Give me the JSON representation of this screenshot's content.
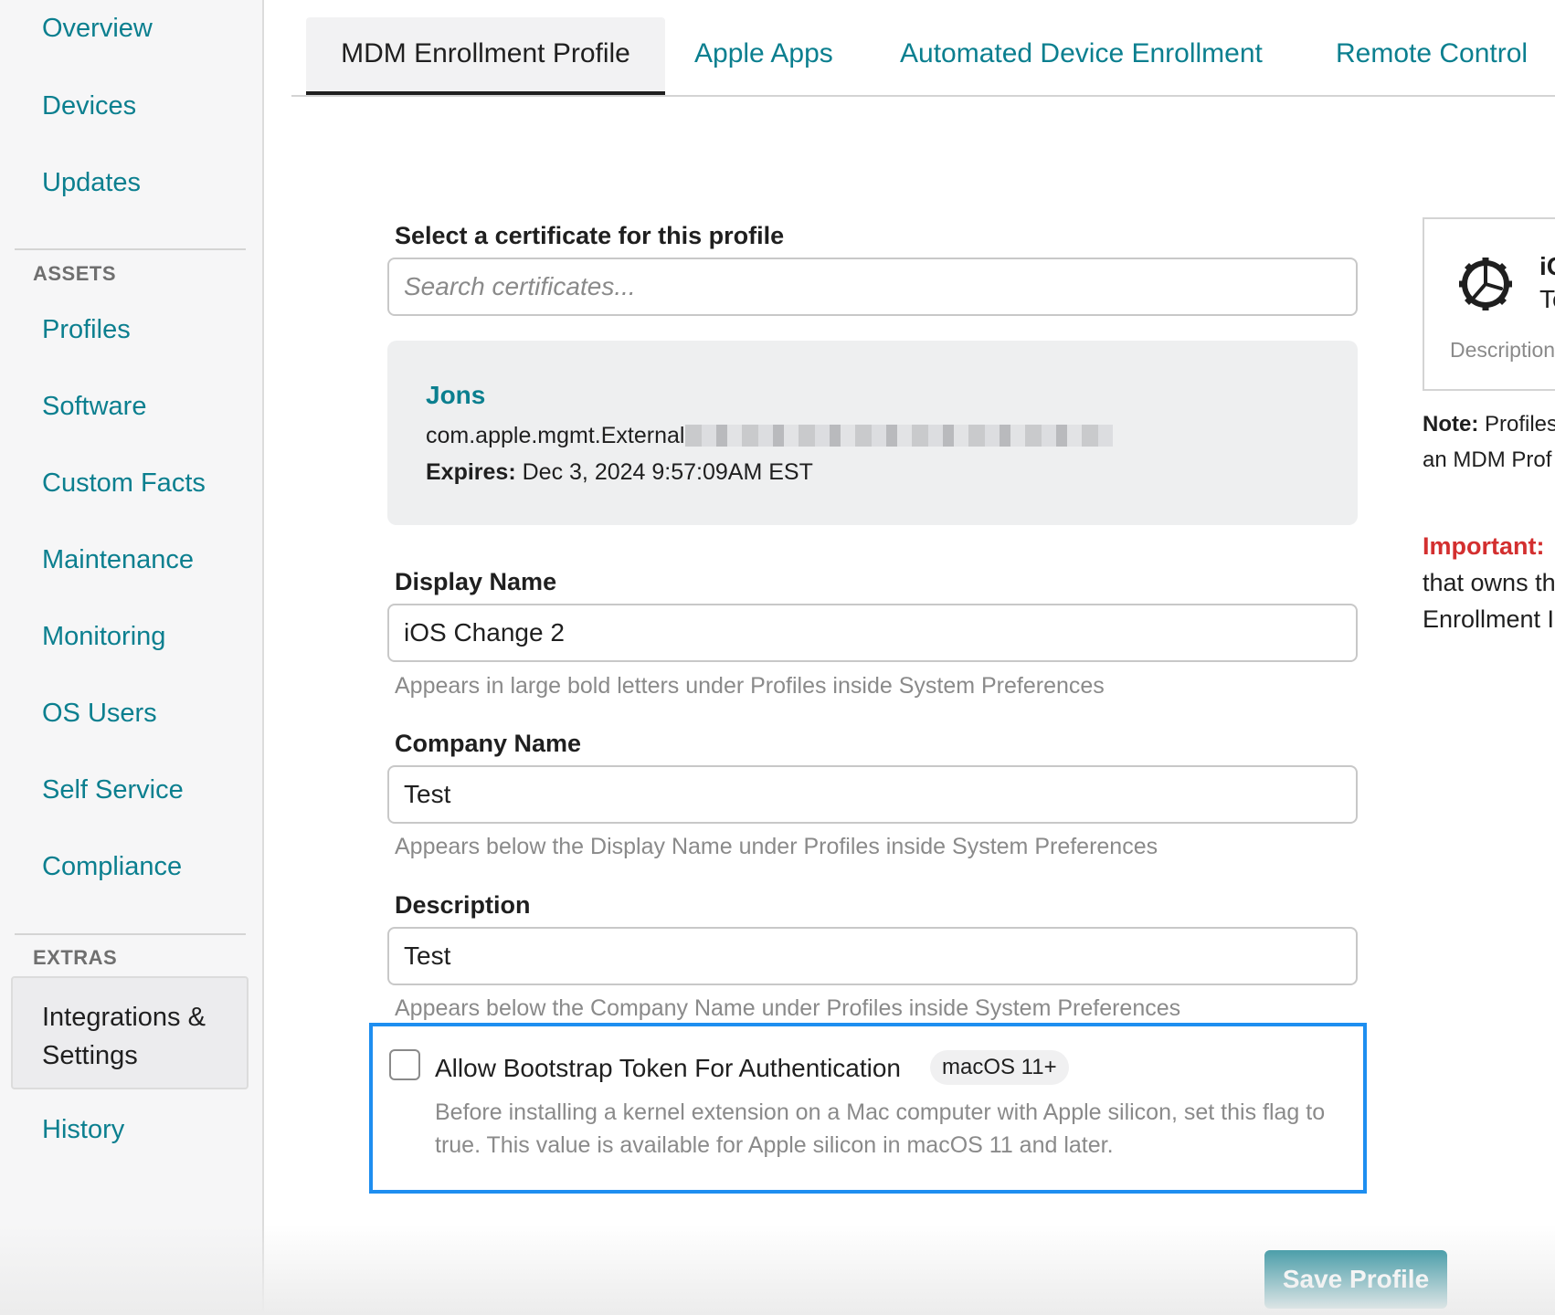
{
  "sidebar": {
    "items": [
      {
        "label": "Overview"
      },
      {
        "label": "Devices"
      },
      {
        "label": "Updates"
      }
    ],
    "assets_heading": "ASSETS",
    "assets": [
      {
        "label": "Profiles"
      },
      {
        "label": "Software"
      },
      {
        "label": "Custom Facts"
      },
      {
        "label": "Maintenance"
      },
      {
        "label": "Monitoring"
      },
      {
        "label": "OS Users"
      },
      {
        "label": "Self Service"
      },
      {
        "label": "Compliance"
      }
    ],
    "extras_heading": "EXTRAS",
    "active_item": "Integrations & Settings",
    "history": "History"
  },
  "tabs": [
    {
      "label": "MDM Enrollment Profile",
      "active": true
    },
    {
      "label": "Apple Apps"
    },
    {
      "label": "Automated Device Enrollment"
    },
    {
      "label": "Remote Control"
    }
  ],
  "form": {
    "certificate_label": "Select a certificate for this profile",
    "certificate_placeholder": "Search certificates...",
    "certificate": {
      "name": "Jons",
      "identifier": "com.apple.mgmt.External",
      "expires_label": "Expires:",
      "expires_value": "Dec 3, 2024 9:57:09AM EST"
    },
    "display_name_label": "Display Name",
    "display_name_value": "iOS Change 2",
    "display_name_help": "Appears in large bold letters under Profiles inside System Preferences",
    "company_name_label": "Company Name",
    "company_name_value": "Test",
    "company_name_help": "Appears below the Display Name under Profiles inside System Preferences",
    "description_label": "Description",
    "description_value": "Test",
    "description_help": "Appears below the Company Name under Profiles inside System Preferences",
    "bootstrap": {
      "label": "Allow Bootstrap Token For Authentication",
      "badge": "macOS 11+",
      "checked": false,
      "description": "Before installing a kernel extension on a Mac computer with Apple silicon, set this flag to true. This value is available for Apple silicon in macOS 11 and later."
    },
    "save_label": "Save Profile"
  },
  "preview": {
    "icon": "gear-icon",
    "title": "iO",
    "subtitle": "Te",
    "description": "Description"
  },
  "notes": {
    "note_label": "Note:",
    "note_line1": "Profiles",
    "note_line2": "an MDM Prof",
    "important_label": "Important:",
    "important_line1": "that owns th",
    "important_line2": "Enrollment I"
  },
  "colors": {
    "accent": "#0b7f8f",
    "highlight_border": "#1e8ef0",
    "important": "#d32f2f"
  }
}
